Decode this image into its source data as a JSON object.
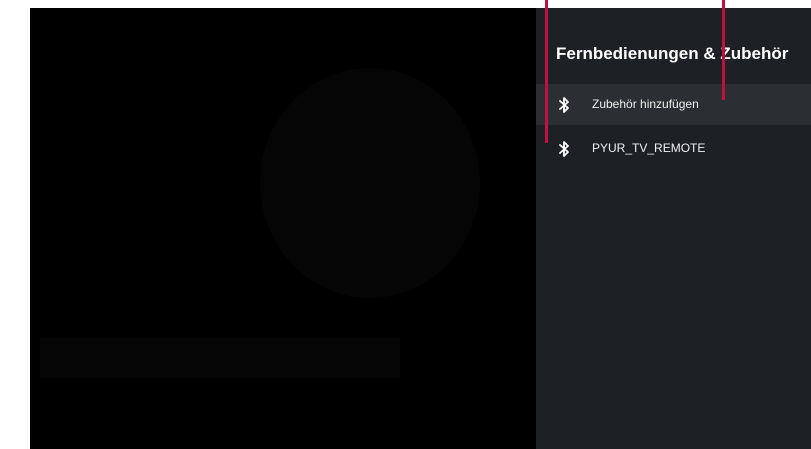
{
  "panel": {
    "title": "Fernbedienungen & Zubehör",
    "items": [
      {
        "label": "Zubehör hinzufügen",
        "icon": "bluetooth-icon",
        "selected": true
      },
      {
        "label": "PYUR_TV_REMOTE",
        "icon": "bluetooth-icon",
        "selected": false
      }
    ]
  },
  "colors": {
    "panel_background": "#1d2024",
    "selected_row": "#2b2f33",
    "callout_line": "#c2113e"
  }
}
